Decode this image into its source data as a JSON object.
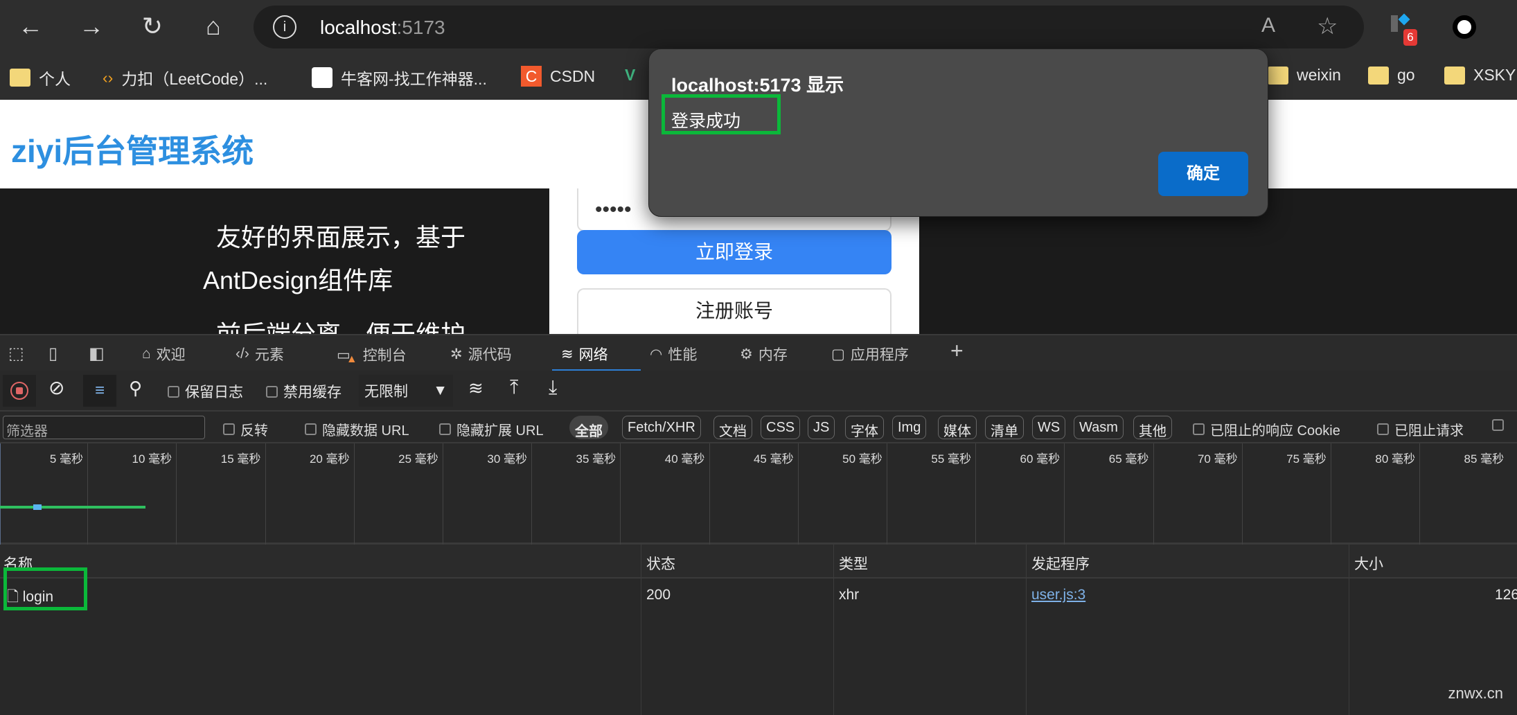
{
  "browser": {
    "url_host": "localhost",
    "url_port": ":5173",
    "badge_count": "6",
    "bookmarks": [
      "个人",
      "力扣（LeetCode）...",
      "牛客网-找工作神器...",
      "CSDN",
      "weixin",
      "go",
      "XSKY"
    ]
  },
  "page": {
    "title": "ziyi后台管理系统",
    "features": [
      "友好的界面展示，基于",
      "AntDesign组件库",
      "前后端分离，便于维护"
    ],
    "password_mask": "•••••",
    "login_button": "立即登录",
    "register_button": "注册账号"
  },
  "dialog": {
    "title": "localhost:5173 显示",
    "message": "登录成功",
    "ok": "确定"
  },
  "devtools": {
    "tabs": [
      "欢迎",
      "元素",
      "控制台",
      "源代码",
      "网络",
      "性能",
      "内存",
      "应用程序"
    ],
    "active_tab": "网络",
    "toolbar": {
      "preserve_log": "保留日志",
      "disable_cache": "禁用缓存",
      "throttle": "无限制"
    },
    "filter": {
      "placeholder": "筛选器",
      "invert": "反转",
      "hide_data_url": "隐藏数据 URL",
      "hide_ext_url": "隐藏扩展 URL",
      "types": [
        "全部",
        "Fetch/XHR",
        "文档",
        "CSS",
        "JS",
        "字体",
        "Img",
        "媒体",
        "清单",
        "WS",
        "Wasm",
        "其他"
      ],
      "selected_type": "全部",
      "blocked_cookies": "已阻止的响应 Cookie",
      "blocked_requests": "已阻止请求"
    },
    "timeline_ticks": [
      "5 毫秒",
      "10 毫秒",
      "15 毫秒",
      "20 毫秒",
      "25 毫秒",
      "30 毫秒",
      "35 毫秒",
      "40 毫秒",
      "45 毫秒",
      "50 毫秒",
      "55 毫秒",
      "60 毫秒",
      "65 毫秒",
      "70 毫秒",
      "75 毫秒",
      "80 毫秒",
      "85 毫秒"
    ],
    "columns": [
      "名称",
      "状态",
      "类型",
      "发起程序",
      "大小"
    ],
    "rows": [
      {
        "name": "login",
        "status": "200",
        "type": "xhr",
        "initiator": "user.js:3",
        "size": "126"
      }
    ]
  },
  "watermark": "znwx.cn"
}
